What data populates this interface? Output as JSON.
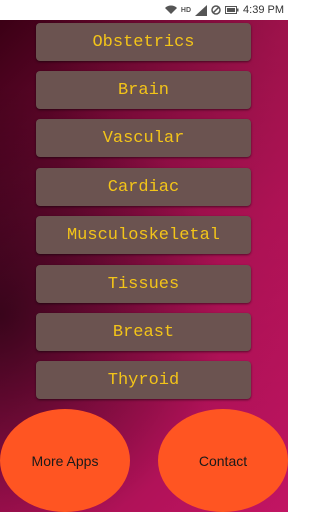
{
  "status_bar": {
    "time": "4:39 PM",
    "icons": [
      "wifi-icon",
      "hd-icon",
      "signal-icon",
      "mute-icon",
      "battery-icon"
    ]
  },
  "menu": {
    "items": [
      {
        "label": "Obstetrics"
      },
      {
        "label": "Brain"
      },
      {
        "label": "Vascular"
      },
      {
        "label": "Cardiac"
      },
      {
        "label": "Musculoskeletal"
      },
      {
        "label": "Tissues"
      },
      {
        "label": "Breast"
      },
      {
        "label": "Thyroid"
      }
    ]
  },
  "footer": {
    "more_apps_label": "More Apps",
    "contact_label": "Contact"
  },
  "colors": {
    "button_bg": "#6b5350",
    "button_text": "#f3c419",
    "circle_bg": "#ff5522",
    "background_dark": "#3b0015",
    "background_light": "#c21563"
  }
}
